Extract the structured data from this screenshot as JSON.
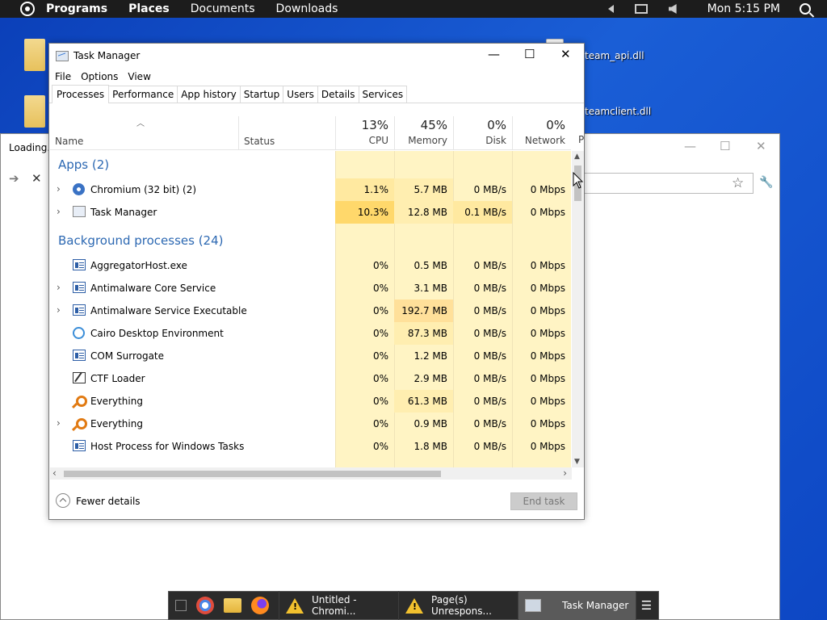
{
  "top_panel": {
    "menus": [
      "Programs",
      "Places",
      "Documents",
      "Downloads"
    ],
    "clock": "Mon 5:15 PM"
  },
  "desktop": {
    "icons": [
      {
        "label": "team_api.dll"
      },
      {
        "label": "teamclient.dll"
      }
    ]
  },
  "browser": {
    "tab_title": "Loading...",
    "minimize": "—",
    "maximize": "☐",
    "close": "✕",
    "back": "➔",
    "stop": "✕"
  },
  "task_manager": {
    "title": "Task Manager",
    "minimize": "—",
    "maximize": "☐",
    "close": "✕",
    "menu": [
      "File",
      "Options",
      "View"
    ],
    "tabs": [
      "Processes",
      "Performance",
      "App history",
      "Startup",
      "Users",
      "Details",
      "Services"
    ],
    "active_tab": "Processes",
    "columns": {
      "name": "Name",
      "status": "Status",
      "cpu": {
        "pct": "13%",
        "label": "CPU"
      },
      "memory": {
        "pct": "45%",
        "label": "Memory"
      },
      "disk": {
        "pct": "0%",
        "label": "Disk"
      },
      "network": {
        "pct": "0%",
        "label": "Network"
      },
      "power": "P"
    },
    "groups": [
      {
        "title": "Apps (2)",
        "rows": [
          {
            "name": "Chromium (32 bit) (2)",
            "icon": "chromium-icon",
            "expandable": true,
            "cpu": "1.1%",
            "mem": "5.7 MB",
            "disk": "0 MB/s",
            "net": "0 Mbps"
          },
          {
            "name": "Task Manager",
            "icon": "task-manager-icon",
            "expandable": true,
            "cpu": "10.3%",
            "mem": "12.8 MB",
            "disk": "0.1 MB/s",
            "net": "0 Mbps"
          }
        ]
      },
      {
        "title": "Background processes (24)",
        "rows": [
          {
            "name": "AggregatorHost.exe",
            "icon": "window-icon",
            "expandable": false,
            "cpu": "0%",
            "mem": "0.5 MB",
            "disk": "0 MB/s",
            "net": "0 Mbps"
          },
          {
            "name": "Antimalware Core Service",
            "icon": "window-icon",
            "expandable": true,
            "cpu": "0%",
            "mem": "3.1 MB",
            "disk": "0 MB/s",
            "net": "0 Mbps"
          },
          {
            "name": "Antimalware Service Executable",
            "icon": "window-icon",
            "expandable": true,
            "cpu": "0%",
            "mem": "192.7 MB",
            "disk": "0 MB/s",
            "net": "0 Mbps"
          },
          {
            "name": "Cairo Desktop Environment",
            "icon": "cairo-icon",
            "expandable": false,
            "cpu": "0%",
            "mem": "87.3 MB",
            "disk": "0 MB/s",
            "net": "0 Mbps"
          },
          {
            "name": "COM Surrogate",
            "icon": "window-icon",
            "expandable": false,
            "cpu": "0%",
            "mem": "1.2 MB",
            "disk": "0 MB/s",
            "net": "0 Mbps"
          },
          {
            "name": "CTF Loader",
            "icon": "ctf-icon",
            "expandable": false,
            "cpu": "0%",
            "mem": "2.9 MB",
            "disk": "0 MB/s",
            "net": "0 Mbps"
          },
          {
            "name": "Everything",
            "icon": "everything-icon",
            "expandable": false,
            "cpu": "0%",
            "mem": "61.3 MB",
            "disk": "0 MB/s",
            "net": "0 Mbps"
          },
          {
            "name": "Everything",
            "icon": "everything-icon",
            "expandable": true,
            "cpu": "0%",
            "mem": "0.9 MB",
            "disk": "0 MB/s",
            "net": "0 Mbps"
          },
          {
            "name": "Host Process for Windows Tasks",
            "icon": "window-icon",
            "expandable": false,
            "cpu": "0%",
            "mem": "1.8 MB",
            "disk": "0 MB/s",
            "net": "0 Mbps"
          }
        ]
      }
    ],
    "footer": {
      "fewer_details": "Fewer details",
      "end_task": "End task"
    }
  },
  "taskbar": {
    "buttons": [
      {
        "label": "Untitled - Chromi...",
        "icon": "warning-icon"
      },
      {
        "label": "Page(s) Unrespons...",
        "icon": "warning-icon"
      },
      {
        "label": "Task Manager",
        "icon": "task-manager-icon"
      }
    ]
  },
  "colors": {
    "desktop": "#1a5ed6",
    "group_header": "#2c68b2",
    "heat_low": "#fff4c4",
    "heat_mid": "#ffe9a0",
    "heat_high": "#ffd86b"
  }
}
